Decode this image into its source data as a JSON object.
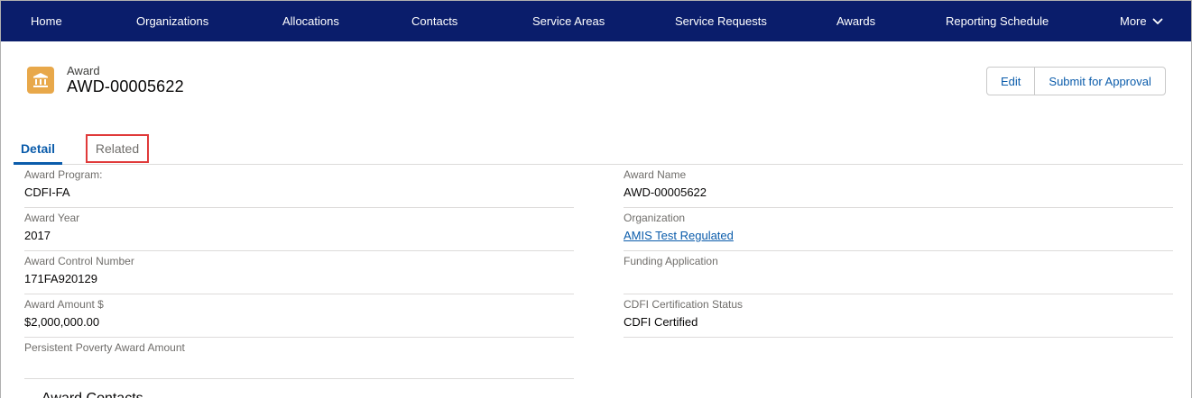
{
  "nav": {
    "items": [
      "Home",
      "Organizations",
      "Allocations",
      "Contacts",
      "Service Areas",
      "Service Requests",
      "Awards",
      "Reporting Schedule"
    ],
    "more_label": "More"
  },
  "header": {
    "object_type": "Award",
    "title": "AWD-00005622",
    "icon": "bank-building-icon",
    "icon_color": "#e8a84a",
    "buttons": {
      "edit": "Edit",
      "submit": "Submit for Approval"
    }
  },
  "tabs": {
    "detail": "Detail",
    "related": "Related",
    "active": "Detail"
  },
  "fields": {
    "left": [
      {
        "label": "Award Program:",
        "value": "CDFI-FA"
      },
      {
        "label": "Award Year",
        "value": "2017"
      },
      {
        "label": "Award Control Number",
        "value": "171FA920129"
      },
      {
        "label": "Award Amount $",
        "value": "$2,000,000.00"
      },
      {
        "label": "Persistent Poverty Award Amount",
        "value": ""
      }
    ],
    "right": [
      {
        "label": "Award Name",
        "value": "AWD-00005622"
      },
      {
        "label": "Organization",
        "value": "AMIS Test Regulated",
        "link": true
      },
      {
        "label": "Funding Application",
        "value": ""
      },
      {
        "label": "CDFI Certification Status",
        "value": "CDFI Certified"
      }
    ]
  },
  "section": {
    "title": "Award Contacts"
  },
  "colors": {
    "nav_bg": "#0a1d6b",
    "link": "#0b5cab",
    "highlight_border": "#e03a3a"
  }
}
